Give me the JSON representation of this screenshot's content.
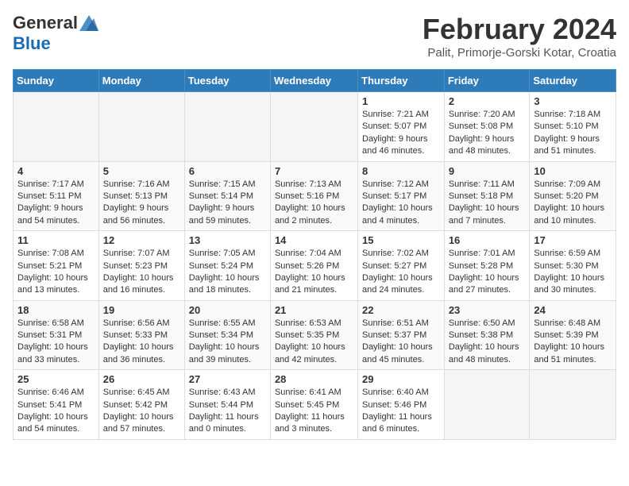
{
  "header": {
    "logo_general": "General",
    "logo_blue": "Blue",
    "month": "February 2024",
    "location": "Palit, Primorje-Gorski Kotar, Croatia"
  },
  "weekdays": [
    "Sunday",
    "Monday",
    "Tuesday",
    "Wednesday",
    "Thursday",
    "Friday",
    "Saturday"
  ],
  "weeks": [
    [
      {
        "day": "",
        "info": ""
      },
      {
        "day": "",
        "info": ""
      },
      {
        "day": "",
        "info": ""
      },
      {
        "day": "",
        "info": ""
      },
      {
        "day": "1",
        "info": "Sunrise: 7:21 AM\nSunset: 5:07 PM\nDaylight: 9 hours\nand 46 minutes."
      },
      {
        "day": "2",
        "info": "Sunrise: 7:20 AM\nSunset: 5:08 PM\nDaylight: 9 hours\nand 48 minutes."
      },
      {
        "day": "3",
        "info": "Sunrise: 7:18 AM\nSunset: 5:10 PM\nDaylight: 9 hours\nand 51 minutes."
      }
    ],
    [
      {
        "day": "4",
        "info": "Sunrise: 7:17 AM\nSunset: 5:11 PM\nDaylight: 9 hours\nand 54 minutes."
      },
      {
        "day": "5",
        "info": "Sunrise: 7:16 AM\nSunset: 5:13 PM\nDaylight: 9 hours\nand 56 minutes."
      },
      {
        "day": "6",
        "info": "Sunrise: 7:15 AM\nSunset: 5:14 PM\nDaylight: 9 hours\nand 59 minutes."
      },
      {
        "day": "7",
        "info": "Sunrise: 7:13 AM\nSunset: 5:16 PM\nDaylight: 10 hours\nand 2 minutes."
      },
      {
        "day": "8",
        "info": "Sunrise: 7:12 AM\nSunset: 5:17 PM\nDaylight: 10 hours\nand 4 minutes."
      },
      {
        "day": "9",
        "info": "Sunrise: 7:11 AM\nSunset: 5:18 PM\nDaylight: 10 hours\nand 7 minutes."
      },
      {
        "day": "10",
        "info": "Sunrise: 7:09 AM\nSunset: 5:20 PM\nDaylight: 10 hours\nand 10 minutes."
      }
    ],
    [
      {
        "day": "11",
        "info": "Sunrise: 7:08 AM\nSunset: 5:21 PM\nDaylight: 10 hours\nand 13 minutes."
      },
      {
        "day": "12",
        "info": "Sunrise: 7:07 AM\nSunset: 5:23 PM\nDaylight: 10 hours\nand 16 minutes."
      },
      {
        "day": "13",
        "info": "Sunrise: 7:05 AM\nSunset: 5:24 PM\nDaylight: 10 hours\nand 18 minutes."
      },
      {
        "day": "14",
        "info": "Sunrise: 7:04 AM\nSunset: 5:26 PM\nDaylight: 10 hours\nand 21 minutes."
      },
      {
        "day": "15",
        "info": "Sunrise: 7:02 AM\nSunset: 5:27 PM\nDaylight: 10 hours\nand 24 minutes."
      },
      {
        "day": "16",
        "info": "Sunrise: 7:01 AM\nSunset: 5:28 PM\nDaylight: 10 hours\nand 27 minutes."
      },
      {
        "day": "17",
        "info": "Sunrise: 6:59 AM\nSunset: 5:30 PM\nDaylight: 10 hours\nand 30 minutes."
      }
    ],
    [
      {
        "day": "18",
        "info": "Sunrise: 6:58 AM\nSunset: 5:31 PM\nDaylight: 10 hours\nand 33 minutes."
      },
      {
        "day": "19",
        "info": "Sunrise: 6:56 AM\nSunset: 5:33 PM\nDaylight: 10 hours\nand 36 minutes."
      },
      {
        "day": "20",
        "info": "Sunrise: 6:55 AM\nSunset: 5:34 PM\nDaylight: 10 hours\nand 39 minutes."
      },
      {
        "day": "21",
        "info": "Sunrise: 6:53 AM\nSunset: 5:35 PM\nDaylight: 10 hours\nand 42 minutes."
      },
      {
        "day": "22",
        "info": "Sunrise: 6:51 AM\nSunset: 5:37 PM\nDaylight: 10 hours\nand 45 minutes."
      },
      {
        "day": "23",
        "info": "Sunrise: 6:50 AM\nSunset: 5:38 PM\nDaylight: 10 hours\nand 48 minutes."
      },
      {
        "day": "24",
        "info": "Sunrise: 6:48 AM\nSunset: 5:39 PM\nDaylight: 10 hours\nand 51 minutes."
      }
    ],
    [
      {
        "day": "25",
        "info": "Sunrise: 6:46 AM\nSunset: 5:41 PM\nDaylight: 10 hours\nand 54 minutes."
      },
      {
        "day": "26",
        "info": "Sunrise: 6:45 AM\nSunset: 5:42 PM\nDaylight: 10 hours\nand 57 minutes."
      },
      {
        "day": "27",
        "info": "Sunrise: 6:43 AM\nSunset: 5:44 PM\nDaylight: 11 hours\nand 0 minutes."
      },
      {
        "day": "28",
        "info": "Sunrise: 6:41 AM\nSunset: 5:45 PM\nDaylight: 11 hours\nand 3 minutes."
      },
      {
        "day": "29",
        "info": "Sunrise: 6:40 AM\nSunset: 5:46 PM\nDaylight: 11 hours\nand 6 minutes."
      },
      {
        "day": "",
        "info": ""
      },
      {
        "day": "",
        "info": ""
      }
    ]
  ]
}
